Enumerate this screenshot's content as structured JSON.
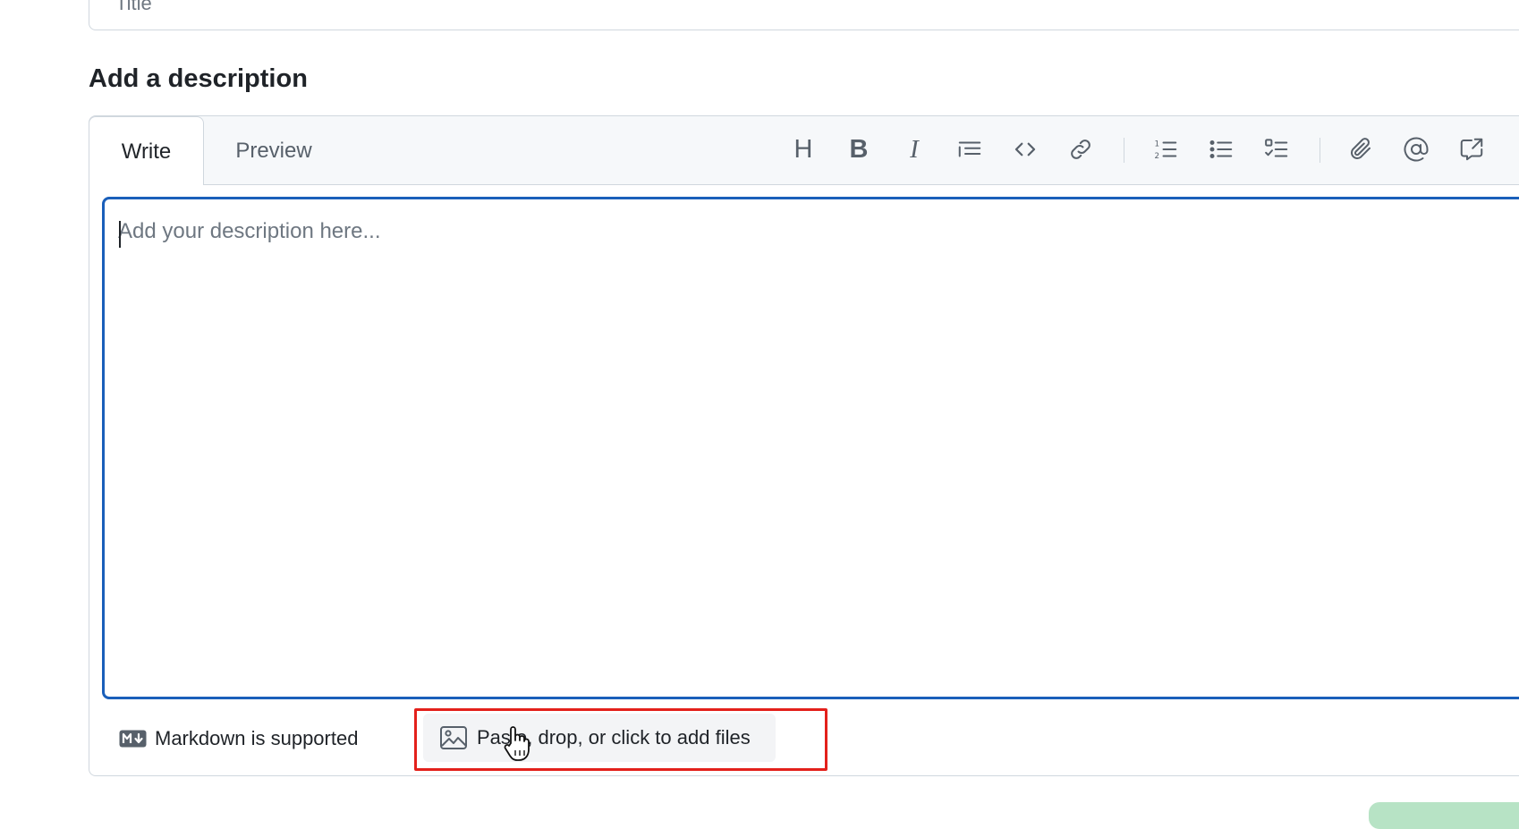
{
  "title_field": {
    "placeholder": "Title"
  },
  "description": {
    "heading": "Add a description",
    "tabs": {
      "write": "Write",
      "preview": "Preview"
    },
    "toolbar_icons": [
      "heading-icon",
      "bold-icon",
      "italic-icon",
      "quote-icon",
      "code-icon",
      "link-icon",
      "ordered-list-icon",
      "unordered-list-icon",
      "task-list-icon",
      "attach-icon",
      "mention-icon",
      "reference-icon"
    ],
    "textarea": {
      "placeholder": "Add your description here...",
      "value": ""
    },
    "footer": {
      "markdown_label": "Markdown is supported",
      "attach_label": "Paste, drop, or click to add files"
    }
  },
  "colors": {
    "focus_border": "#1a5fba",
    "highlight": "#e3201b",
    "muted_text": "#57606a",
    "border": "#d0d7de"
  }
}
